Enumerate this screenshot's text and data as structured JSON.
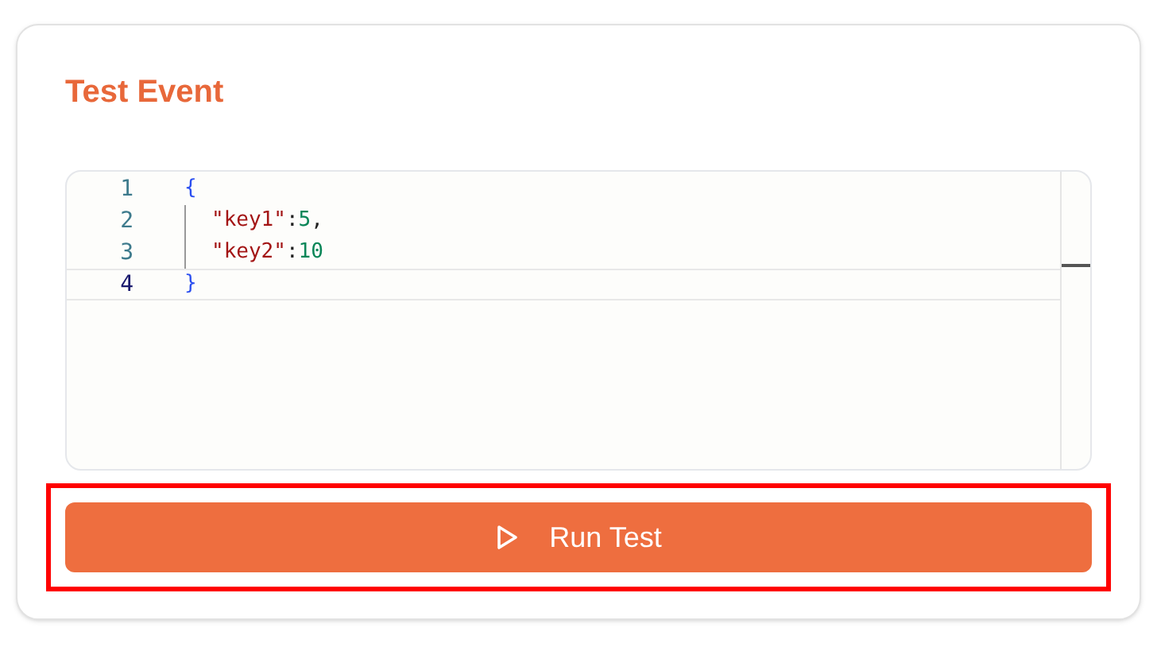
{
  "title": "Test Event",
  "editor": {
    "lines": [
      {
        "number": "1",
        "current": false,
        "tokens": [
          {
            "text": "{",
            "kind": "brace"
          }
        ]
      },
      {
        "number": "2",
        "current": false,
        "tokens": [
          {
            "text": "\"key1\"",
            "kind": "key"
          },
          {
            "text": ":",
            "kind": "punct"
          },
          {
            "text": "5",
            "kind": "number"
          },
          {
            "text": ",",
            "kind": "punct"
          }
        ]
      },
      {
        "number": "3",
        "current": false,
        "tokens": [
          {
            "text": "\"key2\"",
            "kind": "key"
          },
          {
            "text": ":",
            "kind": "punct"
          },
          {
            "text": "10",
            "kind": "number"
          }
        ]
      },
      {
        "number": "4",
        "current": true,
        "tokens": [
          {
            "text": "}",
            "kind": "brace"
          }
        ]
      }
    ]
  },
  "run_button": {
    "label": "Run Test",
    "highlighted": true
  }
}
